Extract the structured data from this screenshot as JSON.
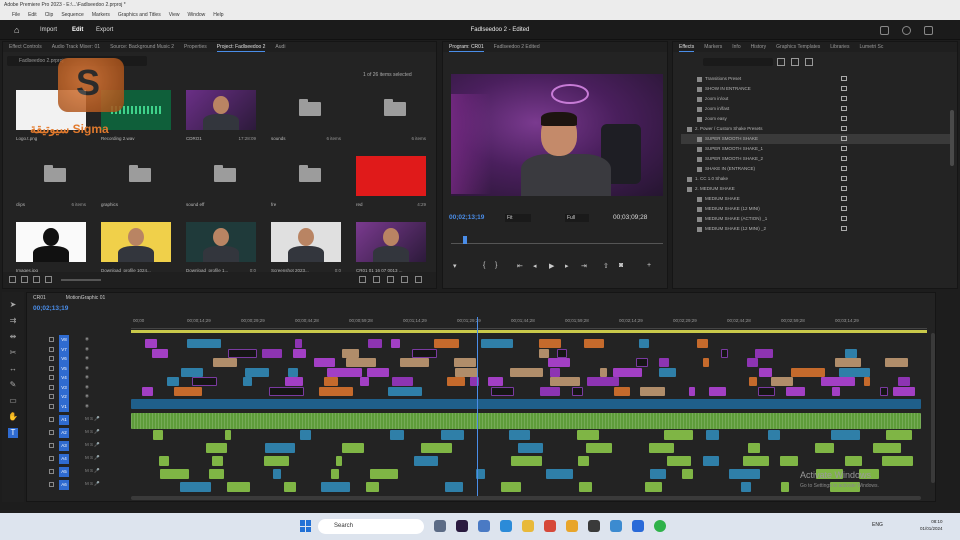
{
  "window": {
    "title": "Adobe Premiere Pro 2023 - E:\\...\\Fadlseedoo 2.prproj *",
    "menu": [
      "File",
      "Edit",
      "Clip",
      "Sequence",
      "Markers",
      "Graphics and Titles",
      "View",
      "Window",
      "Help"
    ]
  },
  "appbar": {
    "workspaces": [
      "Import",
      "Edit",
      "Export"
    ],
    "active_workspace": "Edit",
    "doc_title": "Fadlseedoo 2 - Edited"
  },
  "project": {
    "tabs": [
      "Effect Controls",
      "Audio Track Mixer: 01",
      "Source: Background Music 2",
      "Properties",
      "Project: Fadlseedoo 2",
      "Audi"
    ],
    "active_tab": "Project: Fadlseedoo 2",
    "search_placeholder": "Fadlseedoo 2.prproj",
    "item_count": "1 of 26 items selected",
    "items": [
      {
        "label": "Logo.t.png",
        "meta": "",
        "kind": "image-white"
      },
      {
        "label": "Recording 2.wav",
        "meta": "",
        "kind": "audio"
      },
      {
        "label": "CDRO1",
        "meta": "17:28:09",
        "kind": "video-person"
      },
      {
        "label": "sounds",
        "meta": "6 items",
        "kind": "folder"
      },
      {
        "label": "",
        "meta": "6 items",
        "kind": "folder"
      },
      {
        "label": "clips",
        "meta": "6 items",
        "kind": "folder"
      },
      {
        "label": "graphics",
        "meta": "",
        "kind": "folder"
      },
      {
        "label": "sound eff",
        "meta": "",
        "kind": "folder"
      },
      {
        "label": "fre",
        "meta": "",
        "kind": "folder"
      },
      {
        "label": "red",
        "meta": "4:29",
        "kind": "red"
      },
      {
        "label": "Images.jpg",
        "meta": "",
        "kind": "silhouette"
      },
      {
        "label": "Download_profile 1024...",
        "meta": "",
        "kind": "person-yellow"
      },
      {
        "label": "Download_profile 1...",
        "meta": "0:0",
        "kind": "person-dark"
      },
      {
        "label": "Screenshot 2023...",
        "meta": "0:0",
        "kind": "person-white"
      },
      {
        "label": "CR01 01 16 07 0013 ...",
        "meta": "",
        "kind": "video-duo"
      }
    ]
  },
  "watermark": {
    "text": "سيوتيقة Sigma"
  },
  "program": {
    "tabs": [
      "Program: CR01",
      "Fadlseedoo 2 Edited"
    ],
    "timecode": "00;02;13;19",
    "fit": "Fit",
    "quality": "Full",
    "duration": "00;03;09;28"
  },
  "effects": {
    "tabs": [
      "Effects",
      "Markers",
      "Info",
      "History",
      "Graphics Templates",
      "Libraries",
      "Lumetri Sc"
    ],
    "active_tab": "Effects",
    "search_placeholder": "",
    "rows": [
      {
        "label": "Transitions Preset",
        "indent": 1,
        "selected": false
      },
      {
        "label": "SHOW IN ENTRANCE",
        "indent": 1,
        "selected": false
      },
      {
        "label": "zoom in/out",
        "indent": 1,
        "selected": false
      },
      {
        "label": "zoom in/fast",
        "indent": 1,
        "selected": false
      },
      {
        "label": "zoom easy",
        "indent": 1,
        "selected": false
      },
      {
        "label": "2. Power / Custom Shake Presets",
        "indent": 0,
        "selected": false
      },
      {
        "label": "SUPER SMOOTH SHAKE",
        "indent": 1,
        "selected": true
      },
      {
        "label": "SUPER SMOOTH SHAKE_1",
        "indent": 1,
        "selected": false
      },
      {
        "label": "SUPER SMOOTH SHAKE_2",
        "indent": 1,
        "selected": false
      },
      {
        "label": "SHAKE IN (ENTRANCE)",
        "indent": 1,
        "selected": false
      },
      {
        "label": "1. CC 1.0 Shake",
        "indent": 0,
        "selected": false
      },
      {
        "label": "2. MEDIUM SHAKE",
        "indent": 0,
        "selected": false
      },
      {
        "label": "MEDIUM SHAKE",
        "indent": 1,
        "selected": false
      },
      {
        "label": "MEDIUM SHAKE (12 MINI)",
        "indent": 1,
        "selected": false
      },
      {
        "label": "MEDIUM SHAKE (ACTION) _1",
        "indent": 1,
        "selected": false
      },
      {
        "label": "MEDIUM SHAKE (12 MINI) _2",
        "indent": 1,
        "selected": false
      }
    ]
  },
  "timeline": {
    "tabs": [
      "CR01",
      "MotionGraphic 01"
    ],
    "timecode": "00;02;13;19",
    "ruler": [
      "00;00",
      "00;00;14;29",
      "00;00;29;29",
      "00;00;44;28",
      "00;00;59;28",
      "00;01;14;29",
      "00;01;29;29",
      "00;01;44;28",
      "00;01;59;28",
      "00;02;14;29",
      "00;02;29;29",
      "00;02;44;28",
      "00;02;59;28",
      "00;03;14;29"
    ],
    "video_tracks": [
      "V8",
      "V7",
      "V6",
      "V5",
      "V4",
      "V3",
      "V2",
      "V1"
    ],
    "audio_tracks": [
      "A1",
      "A2",
      "A3",
      "A4",
      "A5",
      "A6"
    ]
  },
  "activation": {
    "line1": "Activate Windows",
    "line2": "Go to Settings to activate Windows."
  },
  "taskbar": {
    "search_placeholder": "Search",
    "lang": "ENG",
    "time": "08:10",
    "date": "01/01/2024"
  },
  "colors": {
    "accent": "#2f6bd0",
    "timecode": "#4a8de8",
    "clip_video": "#a23fc4",
    "clip_audio": "#5e9c3a",
    "watermark": "#e27a2d"
  }
}
